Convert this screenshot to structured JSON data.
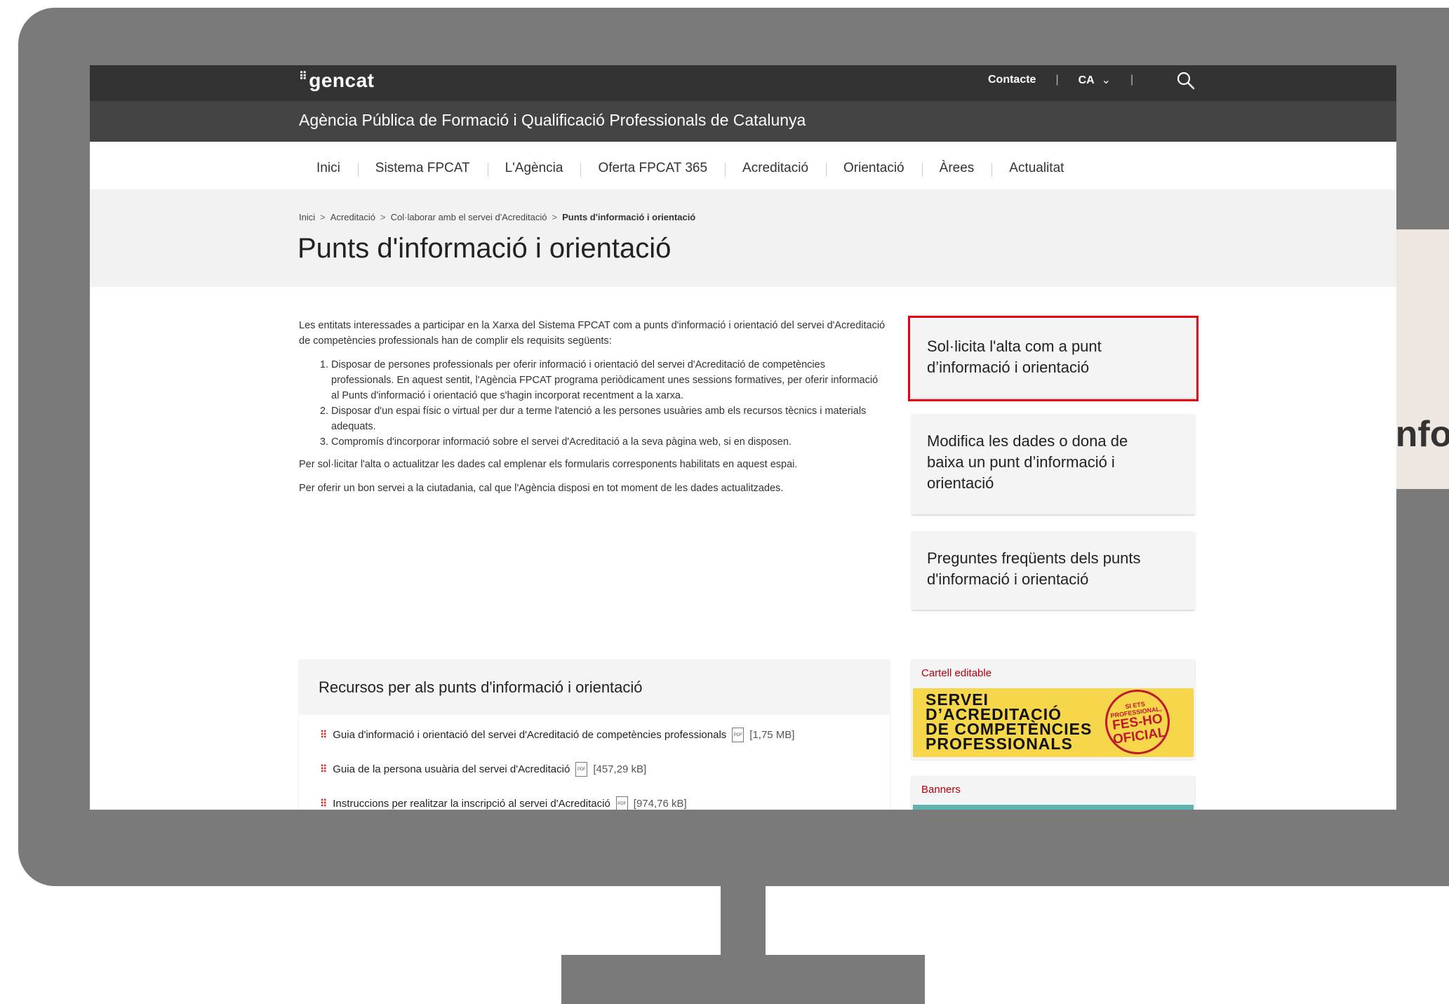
{
  "colors": {
    "accent": "#c0392b",
    "highlight": "#e3000f",
    "topbar": "#333333",
    "callout_bg": "#eee7e1"
  },
  "callout": {
    "text": "d’infor"
  },
  "header": {
    "logo": "gencat",
    "contact": "Contacte",
    "language": "CA",
    "language_caret": "⌄",
    "separator": "|",
    "agency": "Agència Pública de Formació i Qualificació Professionals de Catalunya"
  },
  "nav": [
    {
      "label": "Inici"
    },
    {
      "label": "Sistema FPCAT"
    },
    {
      "label": "L'Agència"
    },
    {
      "label": "Oferta FPCAT 365"
    },
    {
      "label": "Acreditació",
      "active": true
    },
    {
      "label": "Orientació"
    },
    {
      "label": "Àrees"
    },
    {
      "label": "Actualitat"
    }
  ],
  "breadcrumb": {
    "items": [
      "Inici",
      "Acreditació",
      "Col·laborar amb el servei d'Acreditació"
    ],
    "current": "Punts d'informació i orientació",
    "sep": ">"
  },
  "page_title": "Punts d'informació i orientació",
  "content": {
    "intro": "Les entitats interessades a participar en la Xarxa del Sistema FPCAT com a punts d'informació i orientació del servei d'Acreditació de competències professionals han de complir els requisits següents:",
    "requirements": [
      "Disposar de persones professionals per oferir informació i orientació del servei d'Acreditació de competències professionals. En aquest sentit, l'Agència FPCAT programa periòdicament unes sessions formatives, per oferir informació al Punts d'informació i orientació que s'hagin incorporat recentment a la xarxa.",
      "Disposar d'un espai físic o virtual per dur a terme l'atenció a les persones usuàries amb els recursos tècnics i materials adequats.",
      "Compromís d'incorporar informació sobre el servei d'Acreditació a la seva pàgina web, si en disposen."
    ],
    "para2": "Per sol·licitar l'alta o actualitzar les dades cal emplenar els formularis corresponents habilitats en aquest espai.",
    "para3": "Per oferir un bon servei a la ciutadania, cal que l'Agència disposi en tot moment de les dades actualitzades."
  },
  "cards": [
    {
      "label": "Sol·licita l'alta com a punt d’informació i orientació",
      "highlighted": true
    },
    {
      "label": "Modifica les dades o dona de baixa un punt d’informació i orientació"
    },
    {
      "label": "Preguntes freqüents dels punts d'informació i orientació"
    }
  ],
  "resources": {
    "title": "Recursos per als punts d'informació i orientació",
    "items": [
      {
        "label": "Guia d'informació i orientació del servei d'Acreditació de competències professionals",
        "size": "[1,75 MB]"
      },
      {
        "label": "Guia de la persona usuària del servei d'Acreditació",
        "size": "[457,29 kB]"
      },
      {
        "label": "Instruccions per realitzar la inscripció al servei d'Acreditació",
        "size": "[974,76 kB]"
      }
    ],
    "pdf_label": "PDF",
    "bullet": "⠿"
  },
  "sidebar": {
    "poster_label": "Cartell editable",
    "poster_text": "SERVEI\nD’ACREDITACIÓ\nDE COMPETÈNCIES\nPROFESSIONALS",
    "stamp_top": "SI ETS PROFESSIONAL,",
    "stamp_main": "FES-HO OFICIAL",
    "banners_label": "Banners"
  }
}
